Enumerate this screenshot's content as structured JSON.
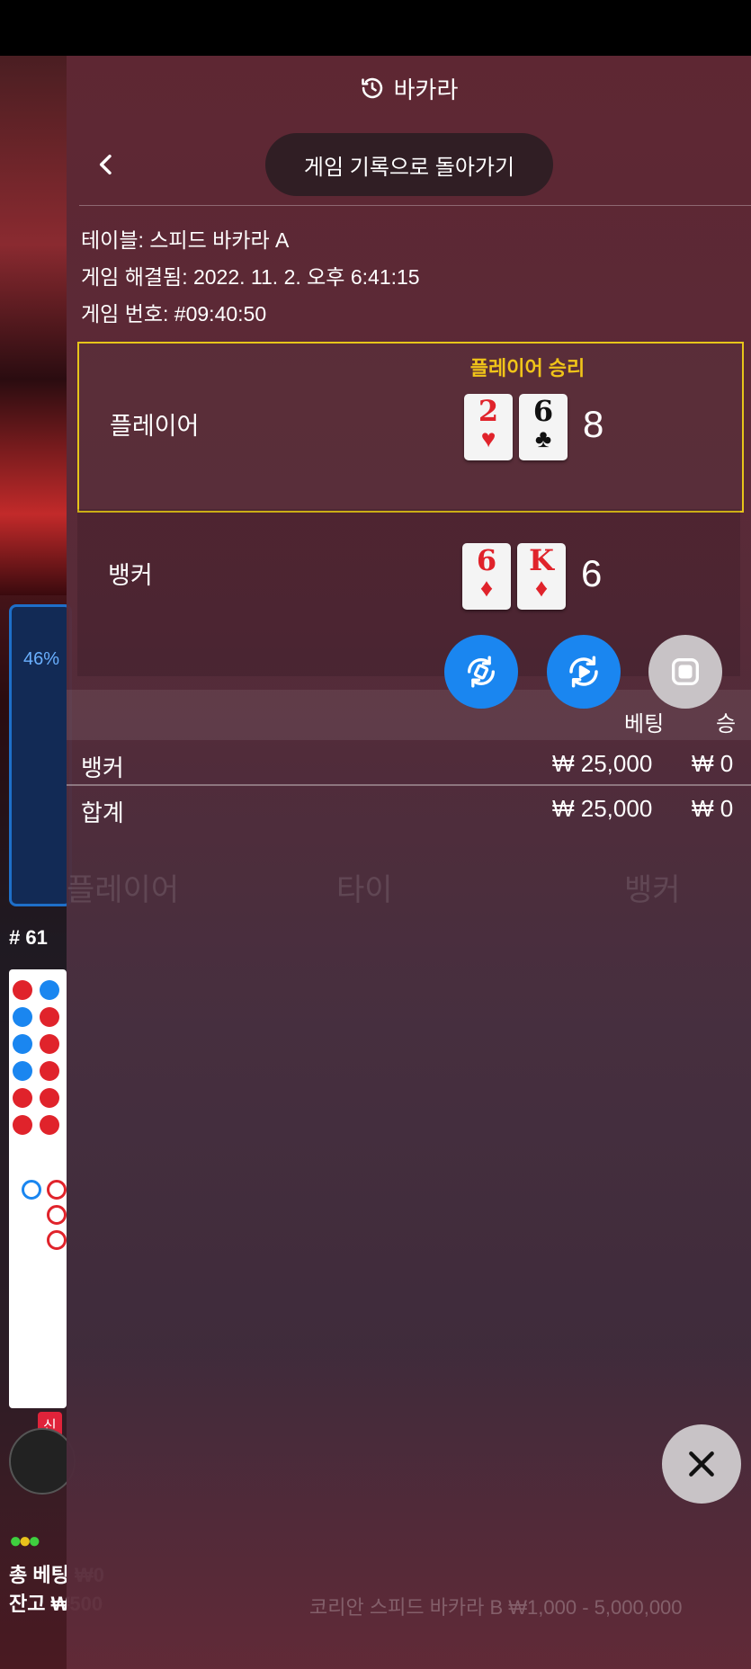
{
  "header": {
    "title": "바카라",
    "icon": "history-icon"
  },
  "nav": {
    "back_button_label": "게임 기록으로 돌아가기"
  },
  "meta": {
    "table": "테이블: 스피드 바카라 A",
    "resolved": "게임 해결됨: 2022. 11. 2. 오후 6:41:15",
    "game_number": "게임 번호: #09:40:50"
  },
  "result_label": "플레이어 승리",
  "hands": {
    "player": {
      "label": "플레이어",
      "cards": [
        {
          "rank": "2",
          "suit": "♥",
          "color": "red"
        },
        {
          "rank": "6",
          "suit": "♣",
          "color": "black"
        }
      ],
      "score": "8"
    },
    "banker": {
      "label": "뱅커",
      "cards": [
        {
          "rank": "6",
          "suit": "♦",
          "color": "red"
        },
        {
          "rank": "K",
          "suit": "♦",
          "color": "red"
        }
      ],
      "score": "6"
    }
  },
  "controls": [
    "rotate-icon",
    "replay-icon",
    "stop-icon"
  ],
  "bets_table": {
    "headers": {
      "bet": "베팅",
      "win": "승"
    },
    "rows": [
      {
        "name": "뱅커",
        "bet": "₩ 25,000",
        "win": "₩ 0"
      }
    ],
    "total": {
      "name": "합계",
      "bet": "₩ 25,000",
      "win": "₩ 0"
    }
  },
  "background": {
    "stats_percent": "46%",
    "round_number": "# 61",
    "new_badge": "신",
    "total_bet": "총 베팅 ₩0",
    "balance": "잔고 ₩500",
    "ghost_tabs": [
      "플레이어",
      "타이",
      "뱅커"
    ],
    "ghost_footer": "코리안 스피드 바카라 B ₩1,000 - 5,000,000"
  },
  "colors": {
    "accent_blue": "#1a86f0",
    "winner_border": "#e7c51a",
    "card_red": "#e0232b"
  }
}
